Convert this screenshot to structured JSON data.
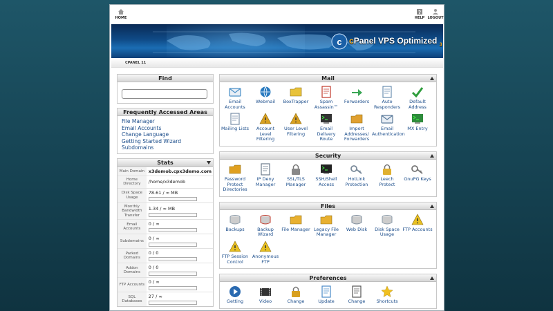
{
  "nav": {
    "home": "HOME",
    "help": "HELP",
    "logout": "LOGOUT"
  },
  "brand": {
    "name_c": "c",
    "name_rest": "Panel VPS Optimized",
    "version": "3",
    "small": "SpamAssassin"
  },
  "breadcrumb": "CPANEL 11",
  "find": {
    "title": "Find",
    "placeholder": "",
    "value": ""
  },
  "faa": {
    "title": "Frequently Accessed Areas",
    "links": [
      "File Manager",
      "Email Accounts",
      "Change Language",
      "Getting Started Wizard",
      "Subdomains"
    ]
  },
  "stats": {
    "title": "Stats",
    "rows": [
      {
        "label": "Main Domain",
        "value": "x3demob.cpx3demo.com",
        "progress": null
      },
      {
        "label": "Home Directory",
        "value": "/home/x3demob",
        "progress": null
      },
      {
        "label": "Disk Space Usage",
        "value": "78.61 / ∞ MB",
        "progress": 0
      },
      {
        "label": "Monthly Bandwidth Transfer",
        "value": "1.34 / ∞ MB",
        "progress": 0
      },
      {
        "label": "Email Accounts",
        "value": "0 / ∞",
        "progress": 0
      },
      {
        "label": "Subdomains",
        "value": "0 / ∞",
        "progress": 0
      },
      {
        "label": "Parked Domains",
        "value": "0 / 0",
        "progress": 0
      },
      {
        "label": "Addon Domains",
        "value": "0 / 0",
        "progress": 0
      },
      {
        "label": "FTP Accounts",
        "value": "0 / ∞",
        "progress": 0
      },
      {
        "label": "SQL Databases",
        "value": "27 / ∞",
        "progress": 0
      }
    ]
  },
  "sections": [
    {
      "title": "Mail",
      "items": [
        {
          "label": "Email Accounts",
          "icon": "email-accounts-icon",
          "color": "#4a90c8"
        },
        {
          "label": "Webmail",
          "icon": "webmail-icon",
          "color": "#2a7bc0"
        },
        {
          "label": "BoxTrapper",
          "icon": "boxtrapper-icon",
          "color": "#e8c23a"
        },
        {
          "label": "Spam Assassin™",
          "icon": "spam-assassin-icon",
          "color": "#c0392b"
        },
        {
          "label": "Forwarders",
          "icon": "forwarders-icon",
          "color": "#3aa655"
        },
        {
          "label": "Auto Responders",
          "icon": "auto-responders-icon",
          "color": "#6b8fb0"
        },
        {
          "label": "Default Address",
          "icon": "default-address-icon",
          "color": "#2e9d3c"
        },
        {
          "label": "Mailing Lists",
          "icon": "mailing-lists-icon",
          "color": "#7a8fa8"
        },
        {
          "label": "Account Level Filtering",
          "icon": "account-filtering-icon",
          "color": "#d8a020"
        },
        {
          "label": "User Level Filtering",
          "icon": "user-filtering-icon",
          "color": "#d8a020"
        },
        {
          "label": "Email Delivery Route",
          "icon": "email-delivery-icon",
          "color": "#333333"
        },
        {
          "label": "Import Addresses/ Forwarders",
          "icon": "import-addresses-icon",
          "color": "#e0a030"
        },
        {
          "label": "Email Authentication",
          "icon": "email-authentication-icon",
          "color": "#5a7a9a"
        },
        {
          "label": "MX Entry",
          "icon": "mx-entry-icon",
          "color": "#2e8b3c"
        }
      ]
    },
    {
      "title": "Security",
      "items": [
        {
          "label": "Password Protect Directories",
          "icon": "password-protect-icon",
          "color": "#e0a020"
        },
        {
          "label": "IP Deny Manager",
          "icon": "ip-deny-icon",
          "color": "#6a7a8a"
        },
        {
          "label": "SSL/TLS Manager",
          "icon": "ssl-tls-icon",
          "color": "#888888"
        },
        {
          "label": "SSH/Shell Access",
          "icon": "ssh-shell-icon",
          "color": "#222222"
        },
        {
          "label": "HotLink Protection",
          "icon": "hotlink-icon",
          "color": "#7a8a9a"
        },
        {
          "label": "Leech Protect",
          "icon": "leech-protect-icon",
          "color": "#e0b030"
        },
        {
          "label": "GnuPG Keys",
          "icon": "gnupg-keys-icon",
          "color": "#777777"
        }
      ]
    },
    {
      "title": "Files",
      "items": [
        {
          "label": "Backups",
          "icon": "backups-icon",
          "color": "#8a9aa8"
        },
        {
          "label": "Backup Wizard",
          "icon": "backup-wizard-icon",
          "color": "#c0392b"
        },
        {
          "label": "File Manager",
          "icon": "file-manager-icon",
          "color": "#e8b030"
        },
        {
          "label": "Legacy File Manager",
          "icon": "legacy-file-manager-icon",
          "color": "#e8b030"
        },
        {
          "label": "Web Disk",
          "icon": "web-disk-icon",
          "color": "#7a8a9a"
        },
        {
          "label": "Disk Space Usage",
          "icon": "disk-space-icon",
          "color": "#8a9aa8"
        },
        {
          "label": "FTP Accounts",
          "icon": "ftp-accounts-icon",
          "color": "#e8c020"
        },
        {
          "label": "FTP Session Control",
          "icon": "ftp-session-icon",
          "color": "#e8c020"
        },
        {
          "label": "Anonymous FTP",
          "icon": "anonymous-ftp-icon",
          "color": "#e8c020"
        }
      ]
    },
    {
      "title": "Preferences",
      "items": [
        {
          "label": "Getting",
          "icon": "getting-started-icon",
          "color": "#2a6ab0"
        },
        {
          "label": "Video",
          "icon": "video-icon",
          "color": "#333333"
        },
        {
          "label": "Change",
          "icon": "change-password-icon",
          "color": "#d8a020"
        },
        {
          "label": "Update",
          "icon": "update-contact-icon",
          "color": "#4a8ac8"
        },
        {
          "label": "Change",
          "icon": "change-language-icon",
          "color": "#555555"
        },
        {
          "label": "Shortcuts",
          "icon": "shortcuts-icon",
          "color": "#f0c020"
        }
      ]
    }
  ]
}
